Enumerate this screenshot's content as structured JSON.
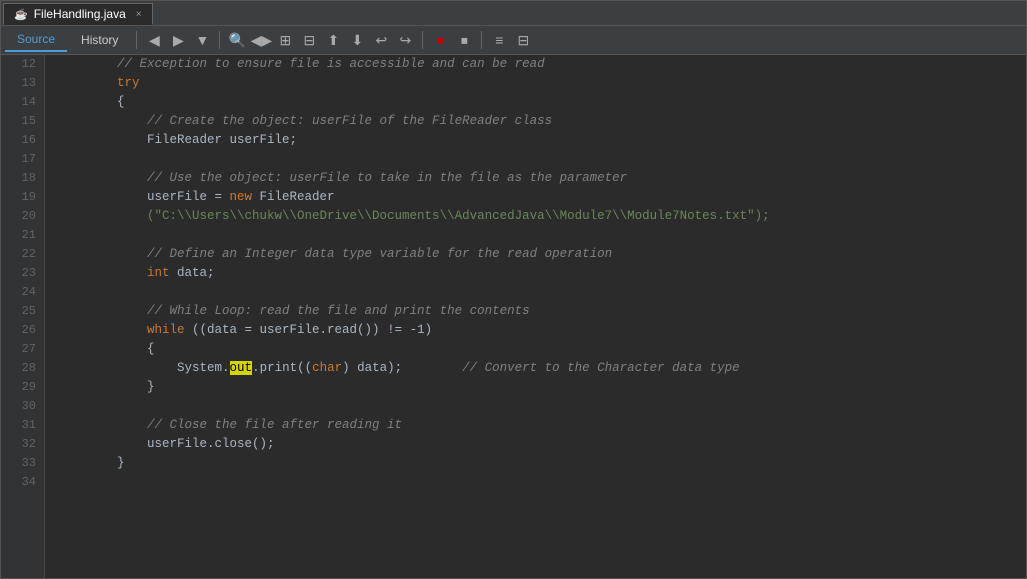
{
  "tab": {
    "filename": "FileHandling.java",
    "close_label": "×"
  },
  "toolbar": {
    "source_label": "Source",
    "history_label": "History"
  },
  "lines": [
    {
      "num": 12,
      "tokens": [
        {
          "t": "        ",
          "c": ""
        },
        {
          "t": "// Exception to ensure file is accessible and can be read",
          "c": "cm"
        }
      ]
    },
    {
      "num": 13,
      "tokens": [
        {
          "t": "        ",
          "c": ""
        },
        {
          "t": "try",
          "c": "kw"
        }
      ]
    },
    {
      "num": 14,
      "tokens": [
        {
          "t": "        ",
          "c": ""
        },
        {
          "t": "{",
          "c": "nm"
        }
      ]
    },
    {
      "num": 15,
      "tokens": [
        {
          "t": "            ",
          "c": ""
        },
        {
          "t": "// Create the object: userFile of the FileReader class",
          "c": "cm"
        }
      ]
    },
    {
      "num": 16,
      "tokens": [
        {
          "t": "            ",
          "c": ""
        },
        {
          "t": "FileReader",
          "c": "cl"
        },
        {
          "t": " userFile;",
          "c": "nm"
        }
      ]
    },
    {
      "num": 17,
      "tokens": []
    },
    {
      "num": 18,
      "tokens": [
        {
          "t": "            ",
          "c": ""
        },
        {
          "t": "// Use the object: userFile to take in the file as the parameter",
          "c": "cm"
        }
      ]
    },
    {
      "num": 19,
      "tokens": [
        {
          "t": "            ",
          "c": ""
        },
        {
          "t": "userFile = ",
          "c": "nm"
        },
        {
          "t": "new",
          "c": "kw"
        },
        {
          "t": " FileReader",
          "c": "nm"
        }
      ]
    },
    {
      "num": 20,
      "tokens": [
        {
          "t": "            ",
          "c": ""
        },
        {
          "t": "(\"C:\\\\Users\\\\chukw\\\\OneDrive\\\\Documents\\\\AdvancedJava\\\\Module7\\\\Module7Notes.txt\");",
          "c": "st"
        }
      ]
    },
    {
      "num": 21,
      "tokens": []
    },
    {
      "num": 22,
      "tokens": [
        {
          "t": "            ",
          "c": ""
        },
        {
          "t": "// Define an Integer data type variable for the read operation",
          "c": "cm"
        }
      ]
    },
    {
      "num": 23,
      "tokens": [
        {
          "t": "            ",
          "c": ""
        },
        {
          "t": "int",
          "c": "kw"
        },
        {
          "t": " data;",
          "c": "nm"
        }
      ]
    },
    {
      "num": 24,
      "tokens": []
    },
    {
      "num": 25,
      "tokens": [
        {
          "t": "            ",
          "c": ""
        },
        {
          "t": "// While Loop: read the file and print the contents",
          "c": "cm"
        }
      ]
    },
    {
      "num": 26,
      "tokens": [
        {
          "t": "            ",
          "c": ""
        },
        {
          "t": "while",
          "c": "kw"
        },
        {
          "t": " ((data = userFile.read()) != -1)",
          "c": "nm"
        }
      ]
    },
    {
      "num": 27,
      "tokens": [
        {
          "t": "            ",
          "c": ""
        },
        {
          "t": "{",
          "c": "nm"
        }
      ]
    },
    {
      "num": 28,
      "tokens": [
        {
          "t": "                ",
          "c": ""
        },
        {
          "t": "System.",
          "c": "nm"
        },
        {
          "t": "out",
          "c": "hl"
        },
        {
          "t": ".print((",
          "c": "nm"
        },
        {
          "t": "char",
          "c": "kw"
        },
        {
          "t": ") data);        ",
          "c": "nm"
        },
        {
          "t": "// Convert to the Character data type",
          "c": "cm"
        }
      ]
    },
    {
      "num": 29,
      "tokens": [
        {
          "t": "            ",
          "c": ""
        },
        {
          "t": "}",
          "c": "nm"
        }
      ]
    },
    {
      "num": 30,
      "tokens": []
    },
    {
      "num": 31,
      "tokens": [
        {
          "t": "            ",
          "c": ""
        },
        {
          "t": "// Close the file after reading it",
          "c": "cm"
        }
      ]
    },
    {
      "num": 32,
      "tokens": [
        {
          "t": "            ",
          "c": ""
        },
        {
          "t": "userFile.close();",
          "c": "nm"
        }
      ]
    },
    {
      "num": 33,
      "tokens": [
        {
          "t": "        ",
          "c": ""
        },
        {
          "t": "}",
          "c": "nm"
        }
      ]
    },
    {
      "num": 34,
      "tokens": []
    }
  ]
}
